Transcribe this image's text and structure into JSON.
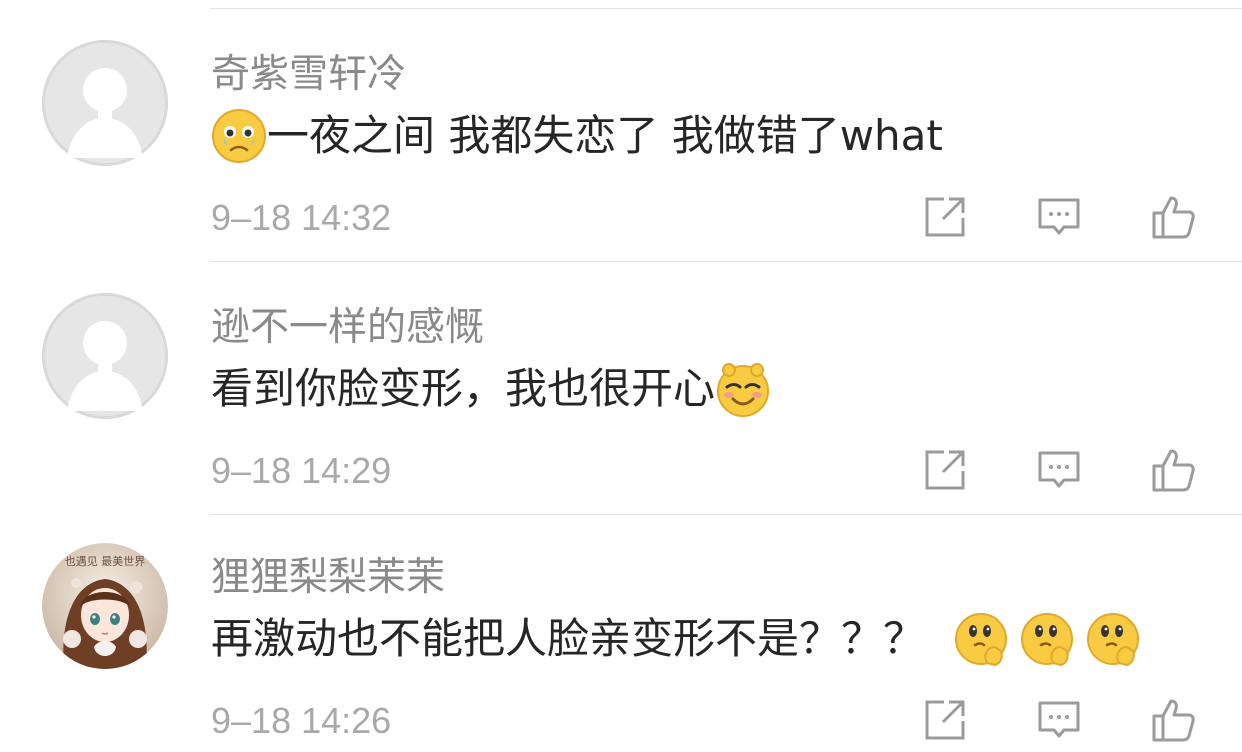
{
  "comments": [
    {
      "username": "奇紫雪轩冷",
      "text": "一夜之间 我都失恋了 我做错了what",
      "time": "9–18 14:32",
      "avatar": "default-avatar",
      "emoji": "teary-face-emoji",
      "emoji_position": "before",
      "emoji_count": 1
    },
    {
      "username": "逊不一样的感慨",
      "text": "看到你脸变形，我也很开心",
      "time": "9–18 14:29",
      "avatar": "default-avatar",
      "emoji": "smug-face-emoji",
      "emoji_position": "after",
      "emoji_count": 1
    },
    {
      "username": "狸狸梨梨茉茉",
      "text": "再激动也不能把人脸亲变形不是？？？",
      "time": "9–18 14:26",
      "avatar": "anime-girl-avatar",
      "avatar_text": "也遇见 最美世界",
      "emoji": "thinking-face-emoji",
      "emoji_position": "after",
      "emoji_count": 3
    }
  ],
  "actions": [
    "share-icon",
    "comment-icon",
    "like-icon"
  ],
  "colors": {
    "username": "#8a8a8a",
    "text": "#262626",
    "time": "#a9a9a9",
    "icon": "#9b9b9b",
    "divider": "#e4e4e4",
    "emoji": "#f8cb42"
  }
}
